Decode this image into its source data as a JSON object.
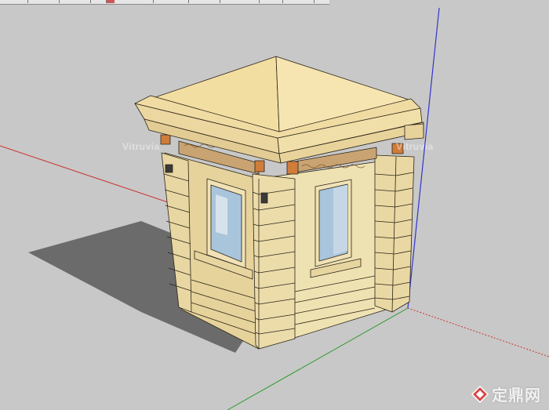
{
  "viewport": {
    "background": "#c8c8c8",
    "axis_colors": {
      "red": "#cc3333",
      "green": "#2f9a2f",
      "blue": "#3333cc"
    }
  },
  "model": {
    "type": "guard booth",
    "wall_color": "#efe2b4",
    "stone_color": "#e7d29a",
    "roof_color": "#f3dea2",
    "window_color": "#a9c5dc",
    "bracket_color": "#cf7d3a"
  },
  "ghost_marks": [
    "Vitruvia",
    "Vitruvia"
  ],
  "watermark": {
    "text": "定鼎网",
    "icon": "diamond-logo-icon"
  }
}
